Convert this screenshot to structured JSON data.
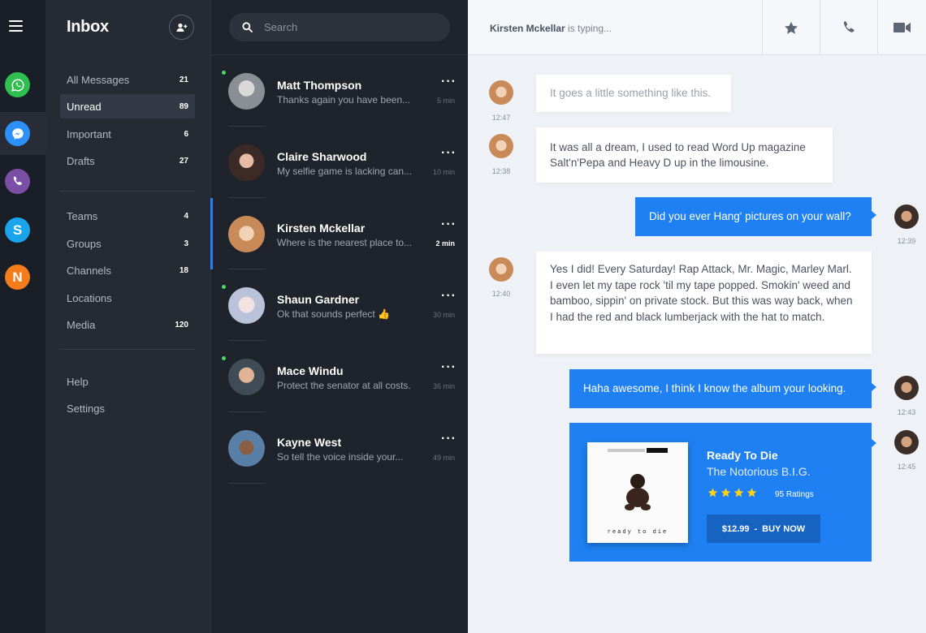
{
  "colors": {
    "accent": "#1e80f2",
    "online": "#4cd964",
    "rail_bg": "#1a1e26",
    "sidebar_bg": "#262a33",
    "list_bg": "#1f232b",
    "chat_bg": "#eef1f5"
  },
  "apps": [
    {
      "name": "whatsapp",
      "color": "#2fbf4f",
      "icon": "whatsapp-icon"
    },
    {
      "name": "messenger",
      "color": "#2d8ff8",
      "icon": "messenger-icon"
    },
    {
      "name": "viber",
      "color": "#7b4fa6",
      "icon": "viber-icon"
    },
    {
      "name": "skype",
      "color": "#1aa4ec",
      "icon": "skype-icon",
      "letter": "S"
    },
    {
      "name": "n-app",
      "color": "#f57c1b",
      "icon": "n-icon",
      "letter": "N"
    }
  ],
  "sidebar": {
    "title": "Inbox",
    "folders": [
      {
        "label": "All Messages",
        "count": "21"
      },
      {
        "label": "Unread",
        "count": "89",
        "active": true
      },
      {
        "label": "Important",
        "count": "6"
      },
      {
        "label": "Drafts",
        "count": "27"
      }
    ],
    "groups": [
      {
        "label": "Teams",
        "count": "4"
      },
      {
        "label": "Groups",
        "count": "3"
      },
      {
        "label": "Channels",
        "count": "18"
      },
      {
        "label": "Locations",
        "count": ""
      },
      {
        "label": "Media",
        "count": "120"
      }
    ],
    "footer": [
      {
        "label": "Help"
      },
      {
        "label": "Settings"
      }
    ]
  },
  "search": {
    "placeholder": "Search"
  },
  "conversations": [
    {
      "name": "Matt Thompson",
      "preview": "Thanks again you have been...",
      "time": "5 min",
      "online": true,
      "avatar_color": "#8a8f96"
    },
    {
      "name": "Claire Sharwood",
      "preview": "My selfie game is lacking can...",
      "time": "10 min",
      "online": false,
      "avatar_color": "#6b4a3f"
    },
    {
      "name": "Kirsten Mckellar",
      "preview": "Where is the nearest place to...",
      "time": "2 min",
      "online": false,
      "active": true,
      "avatar_color": "#c98a5a"
    },
    {
      "name": "Shaun Gardner",
      "preview": "Ok that sounds perfect 👍",
      "time": "30 min",
      "online": true,
      "avatar_color": "#b9c2d8"
    },
    {
      "name": "Mace Windu",
      "preview": "Protect the senator at all costs.",
      "time": "36 min",
      "online": true,
      "avatar_color": "#8d6e58"
    },
    {
      "name": "Kayne West",
      "preview": "So tell the voice inside your...",
      "time": "49 min",
      "online": false,
      "avatar_color": "#5a7fa6"
    }
  ],
  "chat": {
    "contact_name": "Kirsten Mckellar",
    "typing_text": " is typing...",
    "messages": [
      {
        "from": "in",
        "text": "It goes a little something like this.",
        "time": "12:47"
      },
      {
        "from": "in",
        "text": "It was all a dream, I used to read Word Up magazine Salt'n'Pepa and Heavy D up in the limousine.",
        "time": "12:38"
      },
      {
        "from": "out",
        "text": "Did you ever Hang' pictures on your wall?",
        "time": "12:39"
      },
      {
        "from": "in",
        "text": "Yes I did! Every Saturday! Rap Attack, Mr. Magic, Marley Marl. I even let my tape rock 'til my tape popped. Smokin' weed and bamboo, sippin' on private stock.  But this was way back, when I had the red and black lumberjack with the hat to match.",
        "time": "12:40"
      },
      {
        "from": "out",
        "text": "Haha awesome,  I think I know the album your looking.",
        "time": "12:43"
      }
    ],
    "album": {
      "title": "Ready To Die",
      "artist": "The Notorious B.I.G.",
      "rating": 4,
      "rating_max": 5,
      "ratings_text": "95 Ratings",
      "price": "$12.99",
      "buy_label": "BUY NOW",
      "separator": "-",
      "cover_text": "ready to die",
      "time": "12:45"
    }
  }
}
